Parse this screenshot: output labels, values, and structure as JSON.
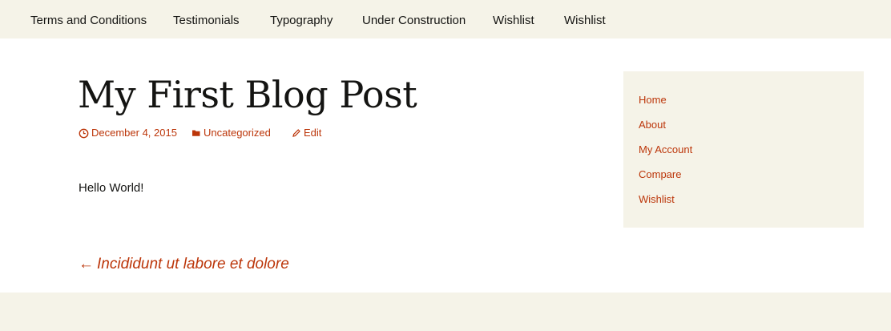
{
  "nav": {
    "items": [
      {
        "label": "Terms and Conditions"
      },
      {
        "label": "Testimonials"
      },
      {
        "label": "Typography"
      },
      {
        "label": "Under Construction"
      },
      {
        "label": "Wishlist"
      },
      {
        "label": "Wishlist"
      }
    ]
  },
  "post": {
    "title": "My First Blog Post",
    "date": "December 4, 2015",
    "category": "Uncategorized",
    "edit_label": "Edit",
    "body": "Hello World!"
  },
  "sidebar": {
    "links": [
      {
        "label": "Home"
      },
      {
        "label": "About"
      },
      {
        "label": "My Account"
      },
      {
        "label": "Compare"
      },
      {
        "label": "Wishlist"
      }
    ]
  },
  "post_nav": {
    "arrow": "←",
    "previous_label": "Incididunt ut labore et dolore"
  },
  "colors": {
    "accent": "#bc360a",
    "band": "#f5f3e8",
    "text": "#141412"
  },
  "icons": {
    "date": "clock-icon",
    "category": "folder-icon",
    "edit": "pencil-icon"
  }
}
